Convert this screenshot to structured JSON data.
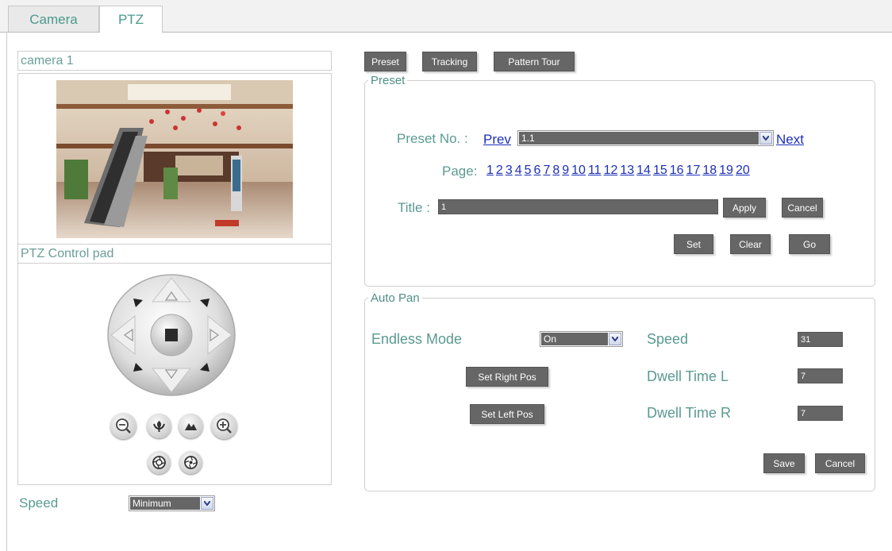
{
  "tabs": [
    "Camera",
    "PTZ"
  ],
  "left": {
    "camera_title": "camera 1",
    "control_pad_title": "PTZ Control pad",
    "speed_label": "Speed",
    "speed_value": "Minimum"
  },
  "top_buttons": [
    "Preset",
    "Tracking",
    "Pattern Tour"
  ],
  "preset": {
    "legend": "Preset",
    "preset_no_label": "Preset No. :",
    "prev": "Prev",
    "next": "Next",
    "preset_value": "1.1",
    "page_label": "Page:",
    "pages": [
      "1",
      "2",
      "3",
      "4",
      "5",
      "6",
      "7",
      "8",
      "9",
      "10",
      "11",
      "12",
      "13",
      "14",
      "15",
      "16",
      "17",
      "18",
      "19",
      "20"
    ],
    "title_label": "Title :",
    "title_value": "1",
    "apply": "Apply",
    "cancel": "Cancel",
    "set": "Set",
    "clear": "Clear",
    "go": "Go"
  },
  "auto_pan": {
    "legend": "Auto Pan",
    "endless_mode_label": "Endless Mode",
    "endless_mode_value": "On",
    "set_right_pos": "Set Right Pos",
    "set_left_pos": "Set Left Pos",
    "speed_label": "Speed",
    "speed_value": "31",
    "dwell_l_label": "Dwell Time L",
    "dwell_l_value": "7",
    "dwell_r_label": "Dwell Time R",
    "dwell_r_value": "7",
    "save": "Save",
    "cancel": "Cancel"
  },
  "icons": [
    "zoom-out-icon",
    "focus-near-icon",
    "focus-far-icon",
    "zoom-in-icon",
    "iris-close-icon",
    "iris-open-icon"
  ]
}
